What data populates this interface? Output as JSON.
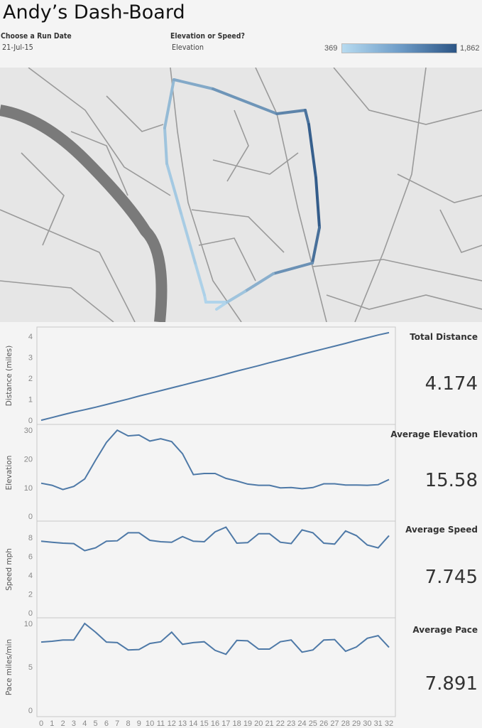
{
  "header": {
    "title": "Andy’s Dash-Board"
  },
  "filters": {
    "run_date": {
      "label": "Choose a Run Date",
      "value": "21-Jul-15"
    },
    "metric": {
      "label": "Elevation or Speed?",
      "value": "Elevation"
    }
  },
  "legend": {
    "min": "369",
    "max": "1,862",
    "color_low": "#b7dbf0",
    "color_high": "#2c5585"
  },
  "kpis": [
    {
      "title": "Total Distance",
      "value": "4.174"
    },
    {
      "title": "Average Elevation",
      "value": "15.58"
    },
    {
      "title": "Average Speed",
      "value": "7.745"
    },
    {
      "title": "Average Pace",
      "value": "7.891"
    }
  ],
  "chart_data": [
    {
      "type": "line",
      "ylabel": "Distance (miles)",
      "ylim": [
        -0.2,
        4.44
      ],
      "yticks": [
        0,
        1,
        2,
        3,
        4
      ],
      "x": [
        0,
        1,
        2,
        3,
        4,
        5,
        6,
        7,
        8,
        9,
        10,
        11,
        12,
        13,
        14,
        15,
        16,
        17,
        18,
        19,
        20,
        21,
        22,
        23,
        24,
        25,
        26,
        27,
        28,
        29,
        30,
        31,
        32
      ],
      "values": [
        0,
        0.13,
        0.26,
        0.39,
        0.5,
        0.62,
        0.75,
        0.88,
        1.01,
        1.15,
        1.28,
        1.41,
        1.54,
        1.67,
        1.8,
        1.93,
        2.06,
        2.2,
        2.34,
        2.47,
        2.6,
        2.74,
        2.87,
        3,
        3.14,
        3.27,
        3.4,
        3.53,
        3.66,
        3.8,
        3.93,
        4.06,
        4.174
      ]
    },
    {
      "type": "line",
      "ylabel": "Elevation",
      "ylim": [
        -1.7,
        32
      ],
      "yticks": [
        0,
        10,
        20,
        30
      ],
      "values": [
        11.5,
        10.8,
        9.3,
        10.4,
        13,
        19.5,
        25.7,
        30,
        28,
        28.3,
        26.2,
        27,
        26,
        21.8,
        14.5,
        14.9,
        14.9,
        13.2,
        12.3,
        11.2,
        10.8,
        10.8,
        9.9,
        10,
        9.6,
        10,
        11.3,
        11.3,
        10.9,
        10.9,
        10.8,
        11,
        12.8
      ]
    },
    {
      "type": "line",
      "ylabel": "Speed mph",
      "ylim": [
        -0.53,
        9.74
      ],
      "yticks": [
        0,
        2,
        4,
        6,
        8
      ],
      "values": [
        7.6,
        7.5,
        7.4,
        7.35,
        6.6,
        6.9,
        7.6,
        7.65,
        8.5,
        8.5,
        7.7,
        7.55,
        7.5,
        8.1,
        7.6,
        7.55,
        8.6,
        9.1,
        7.4,
        7.45,
        8.4,
        8.4,
        7.5,
        7.35,
        8.8,
        8.5,
        7.4,
        7.3,
        8.7,
        8.2,
        7.2,
        6.9,
        8.2
      ]
    },
    {
      "type": "line",
      "ylabel": "Pace miles/min",
      "ylim": [
        -0.74,
        10.66
      ],
      "yticks": [
        0,
        5,
        10
      ],
      "values": [
        7.86,
        7.95,
        8.1,
        8.1,
        10,
        9,
        7.86,
        7.8,
        6.95,
        7,
        7.7,
        7.9,
        9,
        7.6,
        7.8,
        7.9,
        6.9,
        6.45,
        8.05,
        8,
        7.05,
        7.05,
        7.9,
        8.1,
        6.7,
        6.95,
        8.1,
        8.15,
        6.8,
        7.3,
        8.3,
        8.6,
        7.25
      ]
    }
  ],
  "x_ticks": [
    "0",
    "1",
    "2",
    "3",
    "4",
    "5",
    "6",
    "7",
    "8",
    "9",
    "10",
    "11",
    "12",
    "13",
    "14",
    "15",
    "16",
    "17",
    "18",
    "19",
    "20",
    "21",
    "22",
    "23",
    "24",
    "25",
    "26",
    "27",
    "28",
    "29",
    "30",
    "31",
    "32"
  ],
  "line_color": "#4e79a7"
}
